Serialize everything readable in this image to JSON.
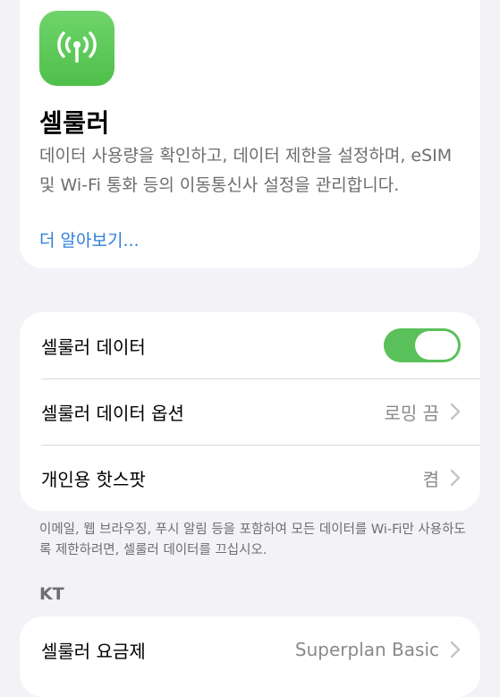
{
  "header": {
    "icon": "antenna-icon",
    "title": "셀룰러",
    "description": "데이터 사용량을 확인하고, 데이터 제한을 설정하며, eSIM 및 Wi-Fi 통화 등의 이동통신사 설정을 관리합니다.",
    "learn_more": "더 알아보기..."
  },
  "settings": {
    "rows": [
      {
        "label": "셀룰러 데이터",
        "toggle_on": true
      },
      {
        "label": "셀룰러 데이터 옵션",
        "value": "로밍 끔"
      },
      {
        "label": "개인용 핫스팟",
        "value": "켬"
      }
    ],
    "footnote": "이메일, 웹 브라우징, 푸시 알림 등을 포함하여 모든 데이터를 Wi-Fi만 사용하도록 제한하려면, 셀룰러 데이터를 끄십시오."
  },
  "carrier": {
    "section_title": "KT",
    "rows": [
      {
        "label": "셀룰러 요금제",
        "value": "Superplan Basic"
      }
    ]
  },
  "colors": {
    "accent_green": "#5ac05a",
    "link_blue": "#2f7fd6",
    "background": "#f2f2f7"
  }
}
